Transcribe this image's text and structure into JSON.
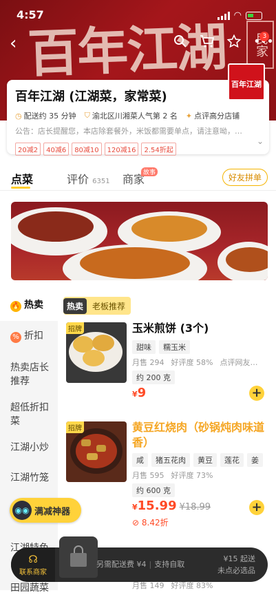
{
  "status": {
    "time": "4:57"
  },
  "hero": {
    "calligraphy": "百年江湖",
    "stamp": "民家"
  },
  "nav": {
    "cart_badge": "3"
  },
  "store": {
    "name": "百年江湖 (江湖菜，家常菜)",
    "logo_text": "百年江湖",
    "delivery_time": "配送约 35 分钟",
    "ranking": "渝北区川湘菜人气第 2 名",
    "reputation": "点评高分店铺",
    "notice": "公告：店长提醒您，本店除套餐外，米饭都需要单点，请注意呦，…",
    "promos": [
      "20减2",
      "40减6",
      "80减10",
      "120减16",
      "2.54折起"
    ]
  },
  "tabs": [
    {
      "label": "点菜",
      "count": ""
    },
    {
      "label": "评价",
      "count": "6351"
    },
    {
      "label": "商家",
      "count": ""
    }
  ],
  "tabs_story_tag": "故事",
  "group_button": "好友拼单",
  "sidebar": [
    {
      "label": "热卖",
      "icon": "flame-icon"
    },
    {
      "label": "折扣",
      "icon": "discount-icon"
    },
    {
      "label": "热卖店长推荐"
    },
    {
      "label": "超低折扣菜"
    },
    {
      "label": "江湖小炒"
    },
    {
      "label": "江湖竹笼"
    },
    {
      "label": "江湖特色"
    },
    {
      "label": "田园蔬菜"
    }
  ],
  "section": {
    "hot": "热卖",
    "title": "老板推荐"
  },
  "dishes": [
    {
      "badge": "招牌",
      "name": "玉米煎饼 (3个)",
      "tags": [
        "甜味",
        "糯玉米"
      ],
      "sales": "月售 294",
      "rating": "好评度 58%",
      "review": "点评网友…",
      "weight": "约 200 克",
      "currency": "¥",
      "price": "9"
    },
    {
      "badge": "招牌",
      "name": "黄豆红烧肉（砂锅炖肉味道香）",
      "tags": [
        "咸",
        "猪五花肉",
        "黄豆",
        "莲花",
        "姜"
      ],
      "sales": "月售 595",
      "rating": "好评度 73%",
      "weight": "约 600 克",
      "currency": "¥",
      "price": "15.99",
      "old_price": "¥18.99",
      "discount": "8.42折"
    }
  ],
  "partial_row": {
    "sales": "月售 149",
    "rating": "好评度 83%"
  },
  "reduce_button": "满减神器",
  "cart": {
    "contact": "联系商家",
    "fee": "另需配送费 ¥4",
    "self_pickup": "支持自取",
    "min_order": "¥15 起送",
    "unselected": "未点必选品"
  },
  "colors": {
    "brand_red": "#a5161b",
    "accent_yellow": "#ffd23a",
    "price_red": "#ff4a26"
  }
}
